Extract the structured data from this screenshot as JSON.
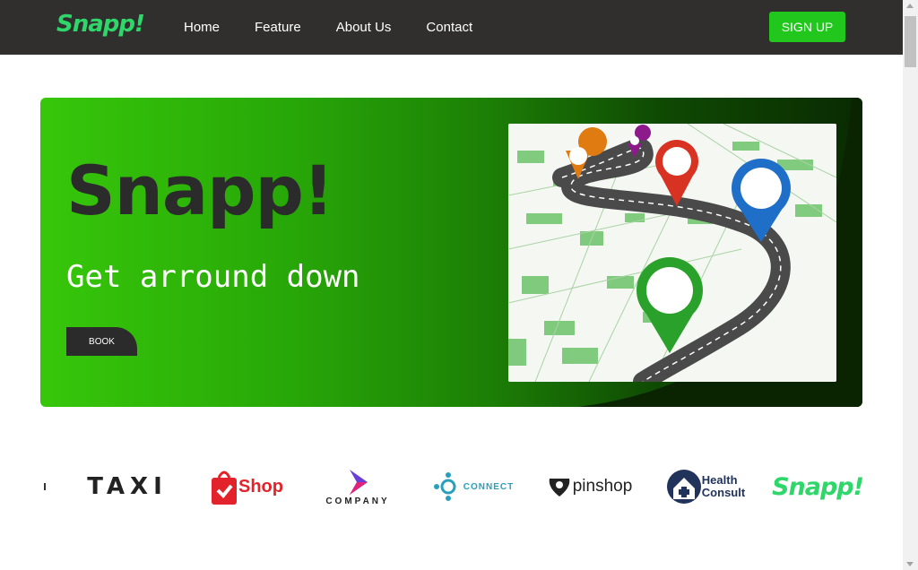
{
  "header": {
    "brand": "Snapp!",
    "nav": [
      "Home",
      "Feature",
      "About Us",
      "Contact"
    ],
    "signup_label": "SIGN UP"
  },
  "hero": {
    "title": "Snapp!",
    "subtitle": "Get arround down",
    "book_label": "BOOK",
    "image_description_icon": "map-route-pins"
  },
  "logos": {
    "taxi": "TAXI",
    "shop": "Shop",
    "company": "COMPANY",
    "connect": "CONNECT",
    "pinshop": "pinshop",
    "health_line1": "Health",
    "health_line2": "Consult",
    "snapp": "Snapp!"
  },
  "colors": {
    "navbar": "#312f2d",
    "brand_green": "#2fd66a",
    "signup_green": "#22c71e",
    "hero_start": "#37c70a",
    "hero_end": "#0a2a02"
  }
}
